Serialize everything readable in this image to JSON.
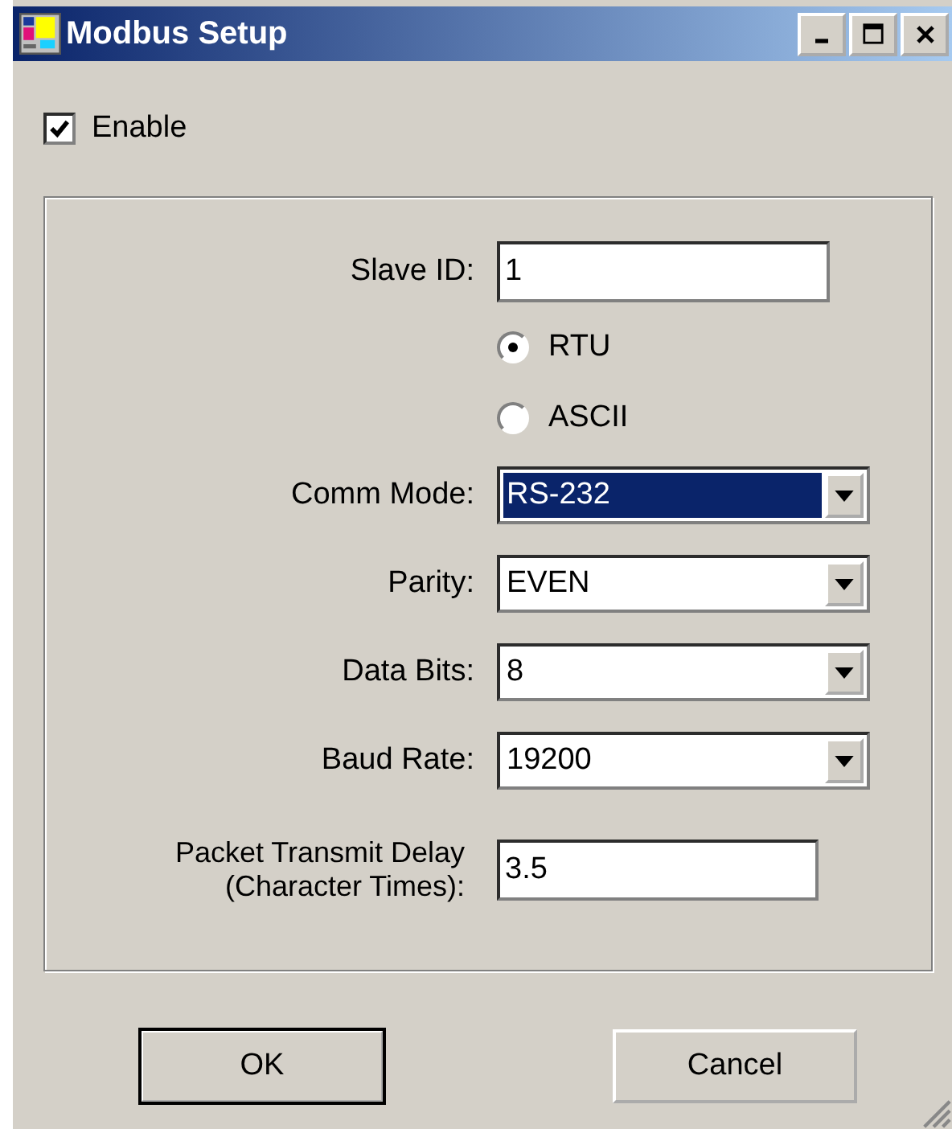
{
  "window": {
    "title": "Modbus Setup"
  },
  "enable": {
    "label": "Enable",
    "checked": true
  },
  "slave_id": {
    "label": "Slave ID:",
    "value": "1"
  },
  "protocol": [
    {
      "label": "RTU",
      "selected": true
    },
    {
      "label": "ASCII",
      "selected": false
    }
  ],
  "dropdowns": [
    {
      "label": "Comm Mode:",
      "value": "RS-232",
      "focused": true
    },
    {
      "label": "Parity:",
      "value": "EVEN",
      "focused": false
    },
    {
      "label": "Data Bits:",
      "value": "8",
      "focused": false
    },
    {
      "label": "Baud Rate:",
      "value": "19200",
      "focused": false
    }
  ],
  "packet_delay": {
    "label": "Packet Transmit Delay\n(Character Times):",
    "value": "3.5"
  },
  "buttons": [
    {
      "label": "OK",
      "default": true
    },
    {
      "label": "Cancel",
      "default": false
    }
  ]
}
